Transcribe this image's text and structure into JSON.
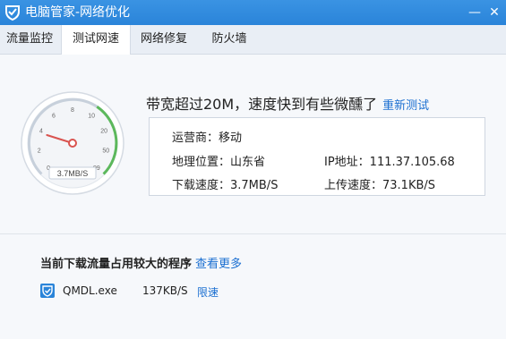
{
  "window": {
    "title": "电脑管家-网络优化",
    "minimize_glyph": "—",
    "close_glyph": "✕"
  },
  "tabs": [
    {
      "label": "流量监控"
    },
    {
      "label": "测试网速"
    },
    {
      "label": "网络修复"
    },
    {
      "label": "防火墙"
    }
  ],
  "active_tab": 1,
  "gauge": {
    "ticks": [
      "0",
      "2",
      "4",
      "6",
      "8",
      "10",
      "20",
      "50",
      "99"
    ],
    "readout": "3.7MB/S",
    "needle_value_mbps": 3.7,
    "accent_color": "#5cb85c",
    "needle_color": "#d9534f"
  },
  "result": {
    "headline": "带宽超过20M，速度快到有些微醺了",
    "retest_link": "重新测试"
  },
  "info": {
    "isp": "运营商：移动",
    "location": "地理位置：山东省",
    "ip": "IP地址：111.37.105.68",
    "download": "下载速度：3.7MB/S",
    "upload": "上传速度：73.1KB/S"
  },
  "programs": {
    "heading": "当前下载流量占用较大的程序",
    "more_link": "查看更多",
    "items": [
      {
        "name": "QMDL.exe",
        "speed": "137KB/S",
        "action": "限速",
        "icon": "qq-shield-icon"
      }
    ]
  },
  "colors": {
    "titlebar": "#2a84d9",
    "link": "#1b6fd1"
  }
}
